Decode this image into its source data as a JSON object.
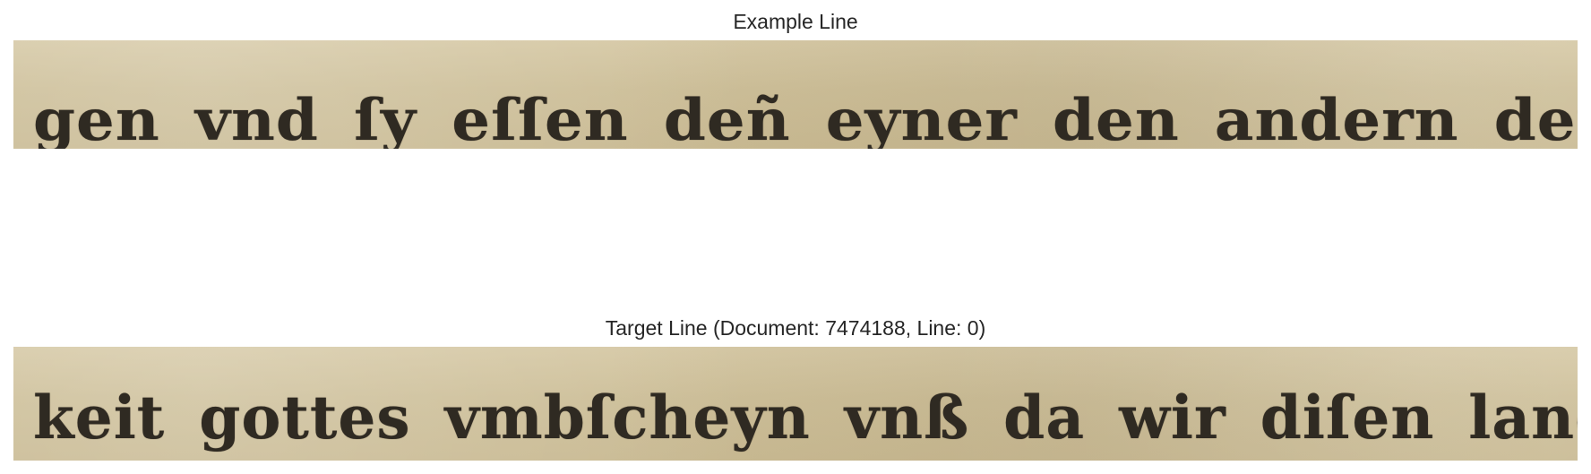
{
  "example": {
    "title": "Example Line",
    "transcription": "gen vnd ſy eſſen deñ eyner den andern der do obligt den"
  },
  "target": {
    "title": "Target Line (Document: 7474188, Line: 0)",
    "transcription": "keit gottes vmbſcheyn vnß da wir diſen landen zů kamē"
  }
}
